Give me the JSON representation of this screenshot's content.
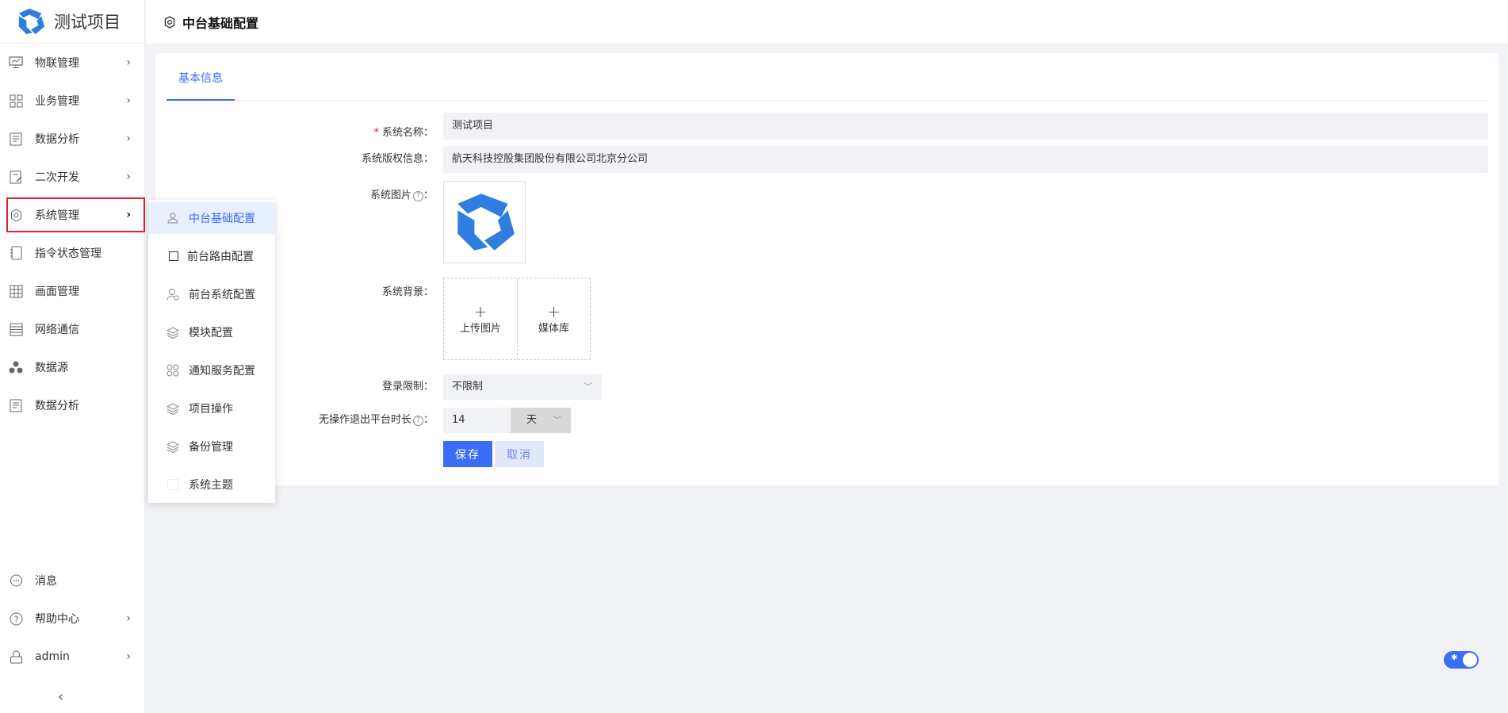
{
  "app": {
    "title": "测试项目"
  },
  "header": {
    "title": "中台基础配置"
  },
  "sidebar": {
    "items": [
      {
        "label": "物联管理",
        "icon": "monitor-icon",
        "has_arrow": true
      },
      {
        "label": "业务管理",
        "icon": "grid-icon",
        "has_arrow": true
      },
      {
        "label": "数据分析",
        "icon": "report-icon",
        "has_arrow": true
      },
      {
        "label": "二次开发",
        "icon": "edit-doc-icon",
        "has_arrow": true
      },
      {
        "label": "系统管理",
        "icon": "gear-icon",
        "has_arrow": true,
        "active": true
      },
      {
        "label": "指令状态管理",
        "icon": "notebook-icon",
        "has_arrow": false
      },
      {
        "label": "画面管理",
        "icon": "table-icon",
        "has_arrow": false
      },
      {
        "label": "网络通信",
        "icon": "list-icon",
        "has_arrow": false
      },
      {
        "label": "数据源",
        "icon": "cluster-icon",
        "has_arrow": false
      },
      {
        "label": "数据分析",
        "icon": "report-icon",
        "has_arrow": false
      }
    ],
    "bottom": [
      {
        "label": "消息",
        "icon": "message-icon",
        "has_arrow": false
      },
      {
        "label": "帮助中心",
        "icon": "help-icon",
        "has_arrow": true
      },
      {
        "label": "admin",
        "icon": "lock-icon",
        "has_arrow": true
      }
    ],
    "collapse": "‹"
  },
  "submenu": {
    "items": [
      {
        "label": "中台基础配置",
        "icon": "user-group-icon",
        "active": true
      },
      {
        "label": "前台路由配置",
        "icon": "square-icon"
      },
      {
        "label": "前台系统配置",
        "icon": "user-settings-icon"
      },
      {
        "label": "模块配置",
        "icon": "layers-icon"
      },
      {
        "label": "通知服务配置",
        "icon": "grid-circles-icon"
      },
      {
        "label": "项目操作",
        "icon": "layers-icon"
      },
      {
        "label": "备份管理",
        "icon": "layers-icon"
      },
      {
        "label": "系统主题",
        "icon": "blank-icon"
      }
    ]
  },
  "tabs": [
    {
      "label": "基本信息"
    }
  ],
  "form": {
    "system_name_label": "系统名称：",
    "system_name_required": "*",
    "system_name_value": "测试项目",
    "copyright_label": "系统版权信息：",
    "copyright_value": "航天科技控股集团股份有限公司北京分公司",
    "image_label": "系统图片",
    "image_suffix": "：",
    "background_label": "系统背景：",
    "upload_label": "上传图片",
    "media_label": "媒体库",
    "plus": "+",
    "login_limit_label": "登录限制：",
    "login_limit_value": "不限制",
    "timeout_label": "无操作退出平台时长",
    "timeout_suffix": "：",
    "timeout_value": "14",
    "timeout_unit": "天",
    "help_mark": "?",
    "save_label": "保存",
    "cancel_label": "取消"
  },
  "colors": {
    "accent": "#3b6ef5",
    "danger": "#e0202a",
    "field_bg": "#f0f2f5"
  }
}
